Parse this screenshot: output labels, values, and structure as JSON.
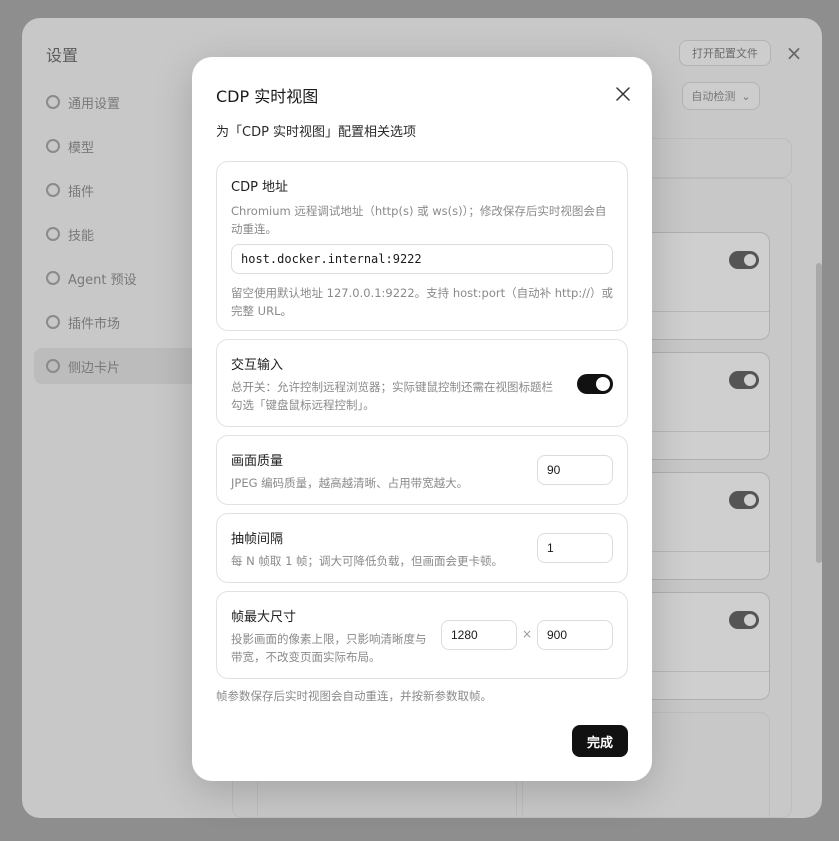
{
  "background": {
    "title": "设置",
    "open_config_label": "打开配置文件",
    "close_icon": "close-icon",
    "autoselect_label": "自动检测",
    "sidebar": [
      {
        "label": "通用设置",
        "icon": "gear-icon",
        "active": false
      },
      {
        "label": "模型",
        "icon": "model-icon",
        "active": false
      },
      {
        "label": "插件",
        "icon": "plugin-icon",
        "active": false
      },
      {
        "label": "技能",
        "icon": "skill-icon",
        "active": false
      },
      {
        "label": "Agent 预设",
        "icon": "agent-icon",
        "active": false
      },
      {
        "label": "插件市场",
        "icon": "market-icon",
        "active": false
      },
      {
        "label": "侧边卡片",
        "icon": "card-icon",
        "active": true
      }
    ]
  },
  "modal": {
    "title": "CDP 实时视图",
    "subtitle": "为「CDP 实时视图」配置相关选项",
    "cdp": {
      "title": "CDP 地址",
      "description": "Chromium 远程调试地址（http(s) 或 ws(s)）；修改保存后实时视图会自动重连。",
      "value": "host.docker.internal:9222",
      "hint": "留空使用默认地址 127.0.0.1:9222。支持 host:port（自动补 http://）或完整 URL。"
    },
    "interactive": {
      "title": "交互输入",
      "description": "总开关：允许控制远程浏览器；实际键鼠控制还需在视图标题栏勾选「键盘鼠标远程控制」。",
      "enabled": true
    },
    "quality": {
      "title": "画面质量",
      "description": "JPEG 编码质量，越高越清晰、占用带宽越大。",
      "value": "90"
    },
    "interval": {
      "title": "抽帧间隔",
      "description": "每 N 帧取 1 帧；调大可降低负载，但画面会更卡顿。",
      "value": "1"
    },
    "max_size": {
      "title": "帧最大尺寸",
      "description": "投影画面的像素上限，只影响清晰度与带宽，不改变页面实际布局。",
      "width": "1280",
      "separator": "×",
      "height": "900"
    },
    "footer_note": "帧参数保存后实时视图会自动重连，并按新参数取帧。",
    "done_label": "完成"
  }
}
